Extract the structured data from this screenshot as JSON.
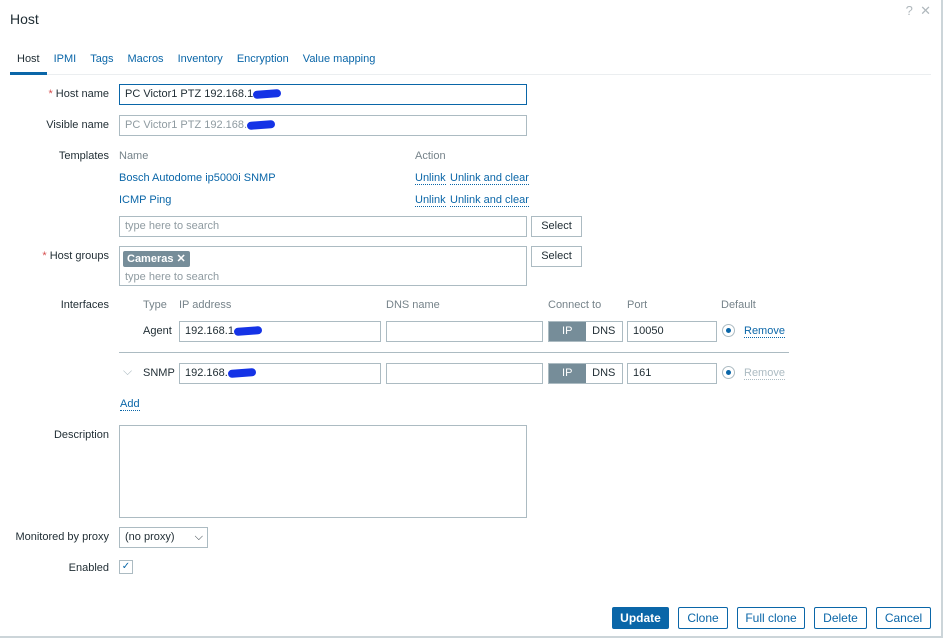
{
  "dialog": {
    "title": "Host",
    "help_icon": "?",
    "close_icon": "✕"
  },
  "tabs": [
    "Host",
    "IPMI",
    "Tags",
    "Macros",
    "Inventory",
    "Encryption",
    "Value mapping"
  ],
  "form": {
    "host_name_label": "Host name",
    "host_name_value": "PC Victor1 PTZ 192.168.1",
    "visible_name_label": "Visible name",
    "visible_name_placeholder": "PC Victor1 PTZ 192.168.",
    "templates_label": "Templates",
    "templates_col_name": "Name",
    "templates_col_action": "Action",
    "templates": [
      {
        "name": "Bosch Autodome ip5000i SNMP",
        "unlink": "Unlink",
        "unlink_clear": "Unlink and clear"
      },
      {
        "name": "ICMP Ping",
        "unlink": "Unlink",
        "unlink_clear": "Unlink and clear"
      }
    ],
    "search_placeholder": "type here to search",
    "select_label": "Select",
    "host_groups_label": "Host groups",
    "host_group_tag": "Cameras",
    "interfaces_label": "Interfaces",
    "iface_headers": {
      "type": "Type",
      "ip": "IP address",
      "dns": "DNS name",
      "connect": "Connect to",
      "port": "Port",
      "default": "Default"
    },
    "interfaces": [
      {
        "type": "Agent",
        "ip": "192.168.1",
        "dns": "",
        "connect_ip": "IP",
        "connect_dns": "DNS",
        "port": "10050",
        "remove": "Remove"
      },
      {
        "type": "SNMP",
        "ip": "192.168.",
        "dns": "",
        "connect_ip": "IP",
        "connect_dns": "DNS",
        "port": "161",
        "remove": "Remove"
      }
    ],
    "add_label": "Add",
    "description_label": "Description",
    "description_value": "",
    "proxy_label": "Monitored by proxy",
    "proxy_value": "(no proxy)",
    "enabled_label": "Enabled",
    "enabled": true
  },
  "footer": {
    "update": "Update",
    "clone": "Clone",
    "full_clone": "Full clone",
    "delete": "Delete",
    "cancel": "Cancel"
  }
}
